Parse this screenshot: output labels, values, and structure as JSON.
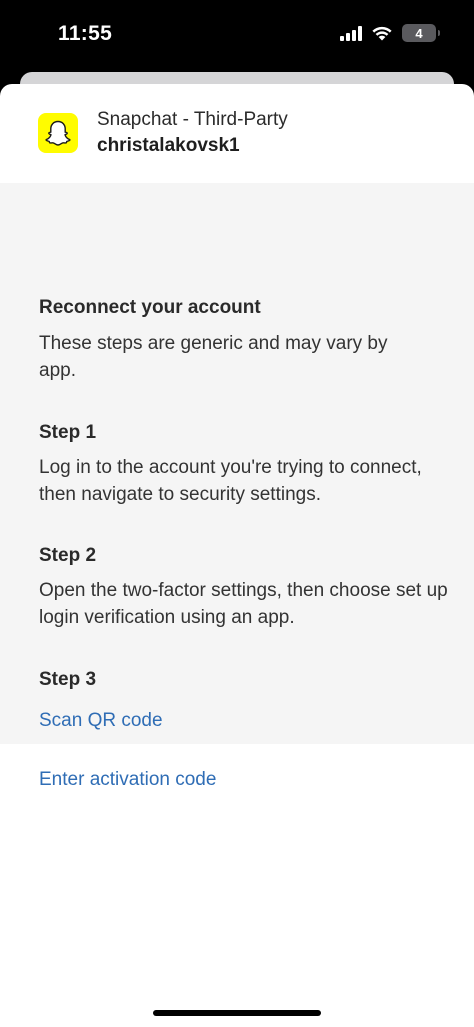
{
  "status_bar": {
    "time": "11:55",
    "battery_level": "4"
  },
  "app": {
    "name": "Snapchat - Third-Party",
    "account": "christalakovsk1",
    "logo_color": "#fffc00"
  },
  "instructions": {
    "title": "Reconnect your account",
    "subtitle": "These steps are generic and may vary by app.",
    "steps": [
      {
        "label": "Step 1",
        "text": "Log in to the account you're trying to connect, then navigate to security settings."
      },
      {
        "label": "Step 2",
        "text": "Open the two-factor settings, then choose set up login verification using an app."
      },
      {
        "label": "Step 3"
      }
    ],
    "scan_qr_label": "Scan QR code",
    "enter_code_label": "Enter activation code"
  },
  "colors": {
    "link": "#2f6db5",
    "panel": "#f5f5f5"
  }
}
